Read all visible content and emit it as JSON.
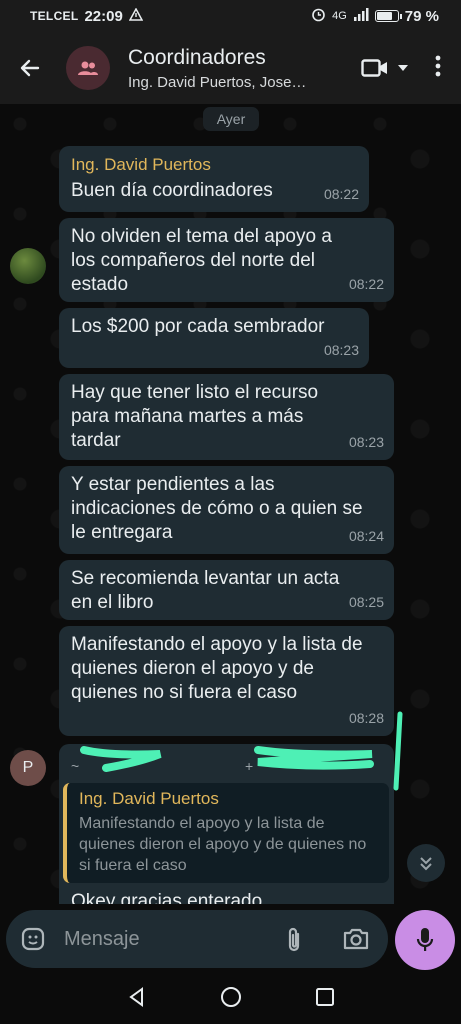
{
  "status_bar": {
    "carrier": "TELCEL",
    "time": "22:09",
    "network": "4G",
    "battery_percent": "79 %",
    "battery_level": 0.79
  },
  "header": {
    "title": "Coordinadores",
    "subtitle": "Ing. David Puertos, Jose…"
  },
  "chat": {
    "day_label": "Ayer",
    "messages": [
      {
        "sender": "Ing. David Puertos",
        "text": "Buen día coordinadores",
        "time": "08:22"
      },
      {
        "text": "No olviden el tema del apoyo a los compañeros del norte del estado",
        "time": "08:22"
      },
      {
        "text": "Los $200 por cada sembrador",
        "time": "08:23"
      },
      {
        "text": "Hay que tener listo el recurso para mañana martes a más tardar",
        "time": "08:23"
      },
      {
        "text": "Y estar pendientes a las indicaciones de cómo o a quien se le entregara",
        "time": "08:24"
      },
      {
        "text": "Se recomienda levantar un acta en el libro",
        "time": "08:25"
      },
      {
        "text": "Manifestando el apoyo y la lista de quienes dieron el apoyo y de quienes no si fuera el caso",
        "time": "08:28"
      }
    ],
    "reply": {
      "avatar_initial": "P",
      "sender_prefix": "~",
      "phone_prefix": "+",
      "quoted_sender": "Ing. David Puertos",
      "quoted_text": "Manifestando el apoyo y la lista de quienes dieron el apoyo y de quienes no si fuera el caso",
      "text": "Okey gracias enterado"
    }
  },
  "input": {
    "placeholder": "Mensaje"
  },
  "colors": {
    "accent_mic": "#c98de5",
    "sender_name": "#e1b75b",
    "bubble": "#1f2c33",
    "redaction": "#4ef0b5"
  },
  "icons": {
    "back": "arrow-left-icon",
    "group_avatar": "group-icon",
    "video": "video-camera-icon",
    "menu": "more-vert-icon",
    "sticker": "sticker-icon",
    "attach": "paperclip-icon",
    "camera": "camera-icon",
    "mic": "microphone-icon",
    "scroll": "double-chevron-down-icon"
  }
}
